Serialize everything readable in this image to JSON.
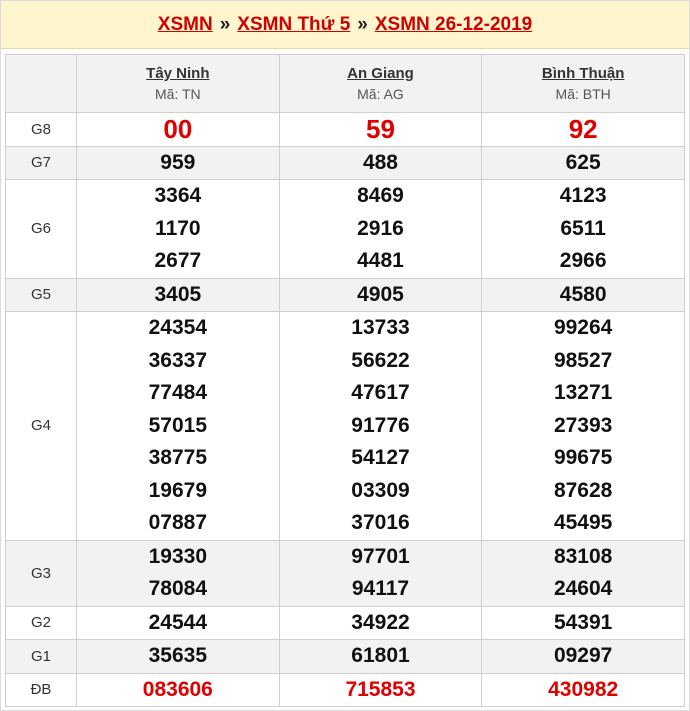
{
  "breadcrumb": {
    "items": [
      "XSMN",
      "XSMN Thứ 5",
      "XSMN 26-12-2019"
    ],
    "separator": "»"
  },
  "provinces": [
    {
      "name": "Tây Ninh",
      "code": "Mã: TN"
    },
    {
      "name": "An Giang",
      "code": "Mã: AG"
    },
    {
      "name": "Bình Thuận",
      "code": "Mã: BTH"
    }
  ],
  "prizes": [
    {
      "label": "G8",
      "values": [
        [
          "00"
        ],
        [
          "59"
        ],
        [
          "92"
        ]
      ]
    },
    {
      "label": "G7",
      "values": [
        [
          "959"
        ],
        [
          "488"
        ],
        [
          "625"
        ]
      ]
    },
    {
      "label": "G6",
      "values": [
        [
          "3364",
          "1170",
          "2677"
        ],
        [
          "8469",
          "2916",
          "4481"
        ],
        [
          "4123",
          "6511",
          "2966"
        ]
      ]
    },
    {
      "label": "G5",
      "values": [
        [
          "3405"
        ],
        [
          "4905"
        ],
        [
          "4580"
        ]
      ]
    },
    {
      "label": "G4",
      "values": [
        [
          "24354",
          "36337",
          "77484",
          "57015",
          "38775",
          "19679",
          "07887"
        ],
        [
          "13733",
          "56622",
          "47617",
          "91776",
          "54127",
          "03309",
          "37016"
        ],
        [
          "99264",
          "98527",
          "13271",
          "27393",
          "99675",
          "87628",
          "45495"
        ]
      ]
    },
    {
      "label": "G3",
      "values": [
        [
          "19330",
          "78084"
        ],
        [
          "97701",
          "94117"
        ],
        [
          "83108",
          "24604"
        ]
      ]
    },
    {
      "label": "G2",
      "values": [
        [
          "24544"
        ],
        [
          "34922"
        ],
        [
          "54391"
        ]
      ]
    },
    {
      "label": "G1",
      "values": [
        [
          "35635"
        ],
        [
          "61801"
        ],
        [
          "09297"
        ]
      ]
    },
    {
      "label": "ĐB",
      "values": [
        [
          "083606"
        ],
        [
          "715853"
        ],
        [
          "430982"
        ]
      ]
    }
  ],
  "colors": {
    "link_red": "#d10000",
    "highlight_red": "#e10000",
    "header_bg": "#fff6cf",
    "row_alt": "#f2f2f2"
  }
}
